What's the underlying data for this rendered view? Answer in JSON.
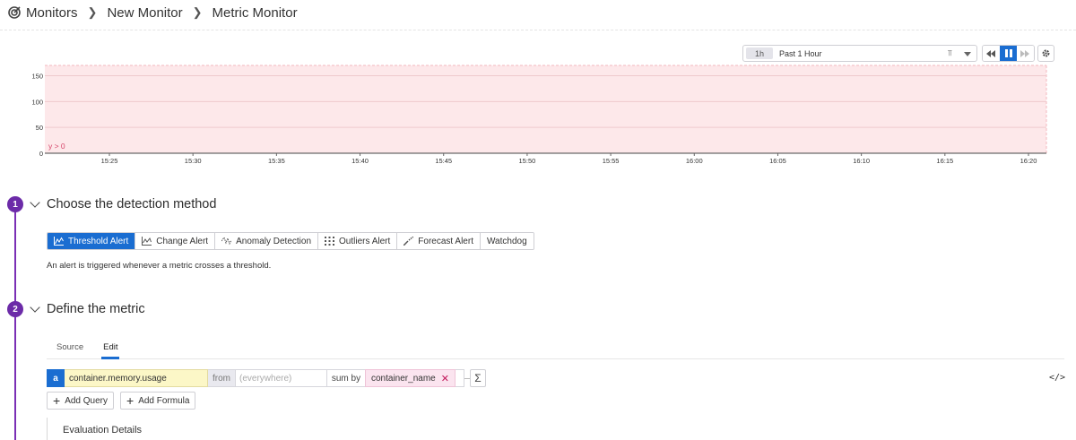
{
  "breadcrumb": {
    "items": [
      "Monitors",
      "New Monitor",
      "Metric Monitor"
    ],
    "logo_icon": "monitor-logo-icon"
  },
  "time_controls": {
    "badge": "1h",
    "range_label": "Past 1 Hour",
    "pin_icon": "pin-icon",
    "playback": [
      "rewind-icon",
      "pause-icon",
      "fast-forward-icon"
    ],
    "settings_icon": "gear-icon"
  },
  "chart_data": {
    "type": "line",
    "y_ticks": [
      "0",
      "50",
      "100",
      "150"
    ],
    "x_ticks": [
      "15:25",
      "15:30",
      "15:35",
      "15:40",
      "15:45",
      "15:50",
      "15:55",
      "16:00",
      "16:05",
      "16:10",
      "16:15",
      "16:20"
    ],
    "ylim": [
      0,
      170
    ],
    "threshold_label": "y > 0",
    "threshold_value": 0,
    "threshold_color": "#fde8ea",
    "grid": true,
    "series": []
  },
  "steps": [
    {
      "number": "1",
      "title": "Choose the detection method"
    },
    {
      "number": "2",
      "title": "Define the metric"
    }
  ],
  "detection": {
    "methods": [
      "Threshold Alert",
      "Change Alert",
      "Anomaly Detection",
      "Outliers Alert",
      "Forecast Alert",
      "Watchdog"
    ],
    "selected": "Threshold Alert",
    "description": "An alert is triggered whenever a metric crosses a threshold."
  },
  "metric": {
    "tabs": [
      "Source",
      "Edit"
    ],
    "active_tab": "Edit",
    "query": {
      "letter": "a",
      "metric": "container.memory.usage",
      "from_label": "from",
      "where_placeholder": "(everywhere)",
      "sum_by_label": "sum by",
      "group_by": "container_name",
      "sigma": "Σ"
    },
    "add_query": "Add Query",
    "add_formula": "Add Formula",
    "code_toggle": "</>"
  },
  "evaluation": {
    "title": "Evaluation Details"
  },
  "colors": {
    "accent": "#1a6dd1",
    "step": "#6c2ba8",
    "threshold_fill": "#fde8ea",
    "threshold_line": "#f2b8bf"
  }
}
